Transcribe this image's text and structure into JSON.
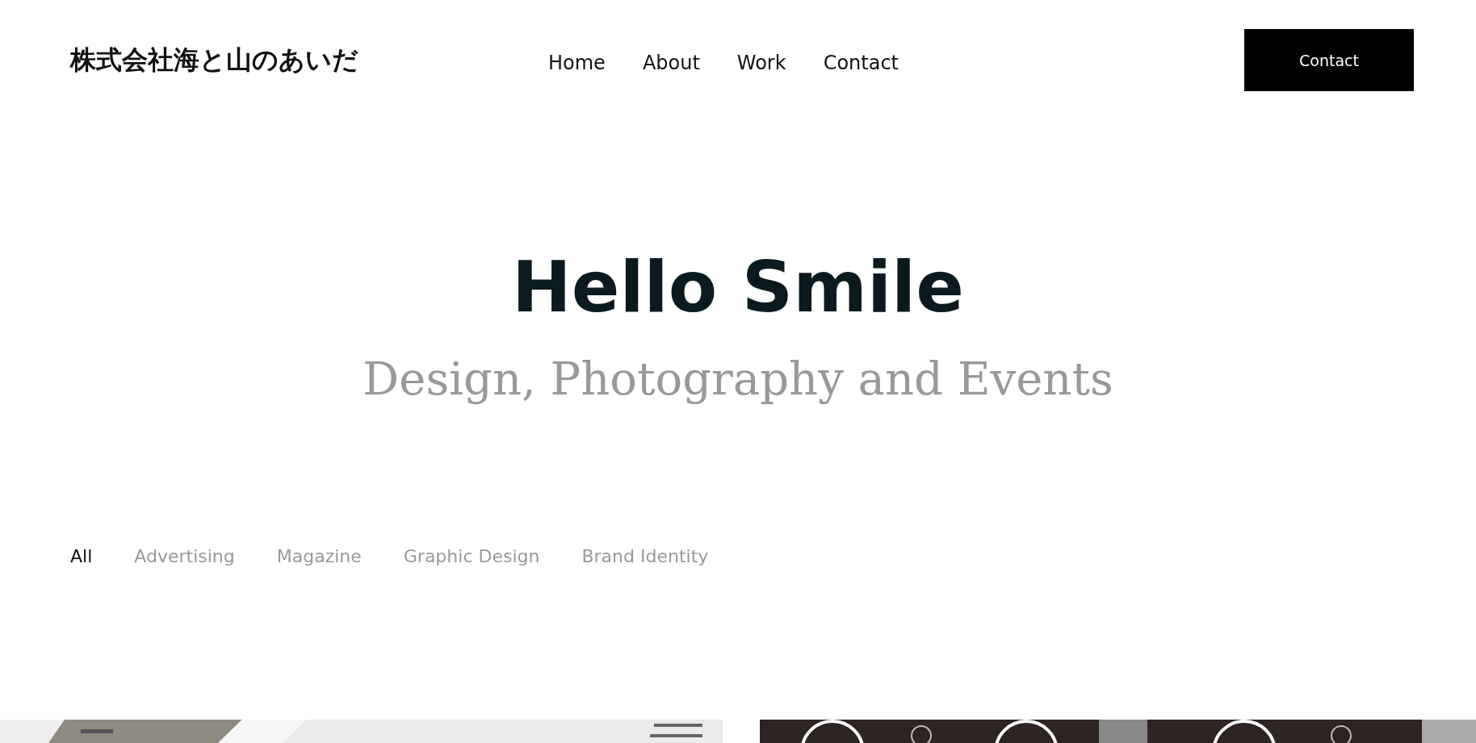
{
  "header": {
    "logo": "株式会社海と山のあいだ",
    "nav": [
      {
        "label": "Home"
      },
      {
        "label": "About"
      },
      {
        "label": "Work"
      },
      {
        "label": "Contact"
      }
    ],
    "cta": "Contact"
  },
  "hero": {
    "title": "Hello Smile",
    "subtitle": "Design, Photography and Events"
  },
  "filters": [
    {
      "label": "All",
      "selected": true
    },
    {
      "label": "Advertising",
      "selected": false
    },
    {
      "label": "Magazine",
      "selected": false
    },
    {
      "label": "Graphic Design",
      "selected": false
    },
    {
      "label": "Brand Identity",
      "selected": false
    }
  ]
}
